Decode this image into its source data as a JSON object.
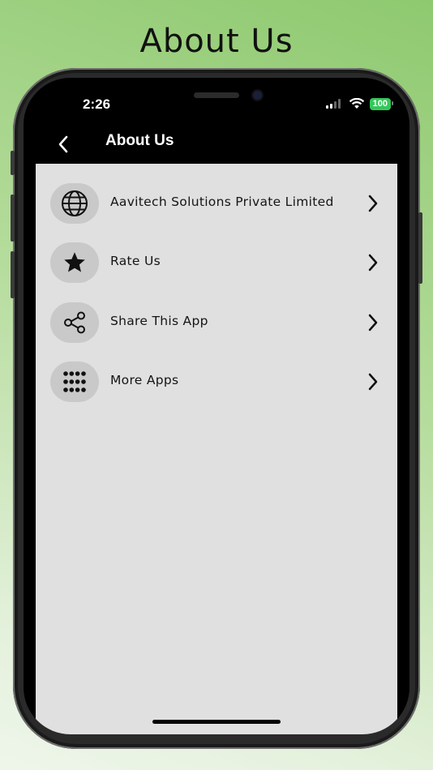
{
  "promo": {
    "title": "About Us"
  },
  "status_bar": {
    "time": "2:26",
    "battery": "100"
  },
  "nav": {
    "title": "About Us"
  },
  "menu": {
    "items": [
      {
        "label": "Aavitech Solutions Private Limited",
        "icon": "globe-icon"
      },
      {
        "label": "Rate Us",
        "icon": "star-icon"
      },
      {
        "label": "Share This App",
        "icon": "share-icon"
      },
      {
        "label": "More Apps",
        "icon": "grid-icon"
      }
    ]
  },
  "colors": {
    "accent_green": "#34c759",
    "background_green": "#8ec96f",
    "content_bg": "#e0e0e0",
    "icon_circle": "#c9c9c9"
  }
}
